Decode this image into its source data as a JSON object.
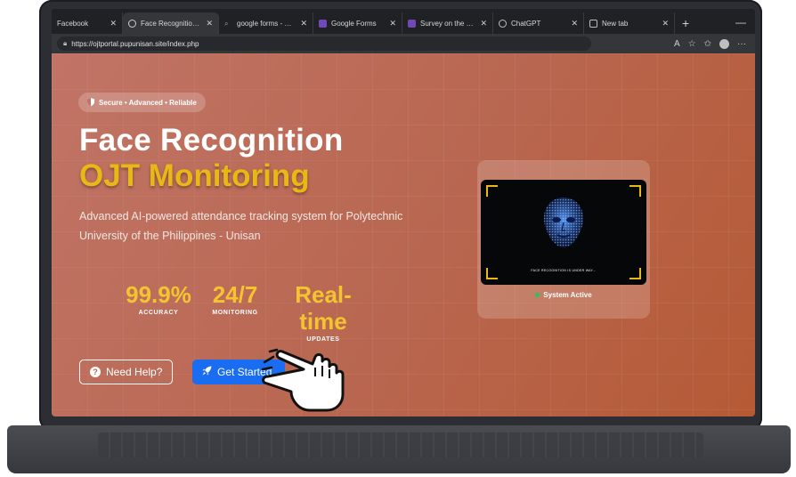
{
  "browser": {
    "tabs": [
      {
        "label": "Facebook",
        "icon": "facebook-icon",
        "active": false
      },
      {
        "label": "Face Recognition C",
        "icon": "globe-icon",
        "active": true
      },
      {
        "label": "google forms - Sea",
        "icon": "search-icon",
        "active": false
      },
      {
        "label": "Google Forms",
        "icon": "forms-icon",
        "active": false
      },
      {
        "label": "Survey on the Devi",
        "icon": "forms-icon",
        "active": false
      },
      {
        "label": "ChatGPT",
        "icon": "chatgpt-icon",
        "active": false
      },
      {
        "label": "New tab",
        "icon": "newtab-icon",
        "active": false
      }
    ],
    "url": "https://ojtportal.pupunisan.site/index.php"
  },
  "hero": {
    "badge": "Secure • Advanced • Reliable",
    "title_line1": "Face Recognition",
    "title_line2": "OJT Monitoring",
    "description": "Advanced AI-powered attendance tracking system for Polytechnic University of the Philippines - Unisan",
    "stats": [
      {
        "value": "99.9%",
        "label": "ACCURACY"
      },
      {
        "value": "24/7",
        "label": "MONITORING"
      },
      {
        "value": "Real-time",
        "label": "UPDATES"
      }
    ],
    "buttons": {
      "help": "Need Help?",
      "start": "Get Started"
    }
  },
  "camera": {
    "caption": "FACE RECOGNITION IS UNDER WAY...",
    "status": "System Active"
  },
  "colors": {
    "accent_gold": "#e8b914",
    "button_blue": "#1a6cf0",
    "status_green": "#22c55e"
  }
}
